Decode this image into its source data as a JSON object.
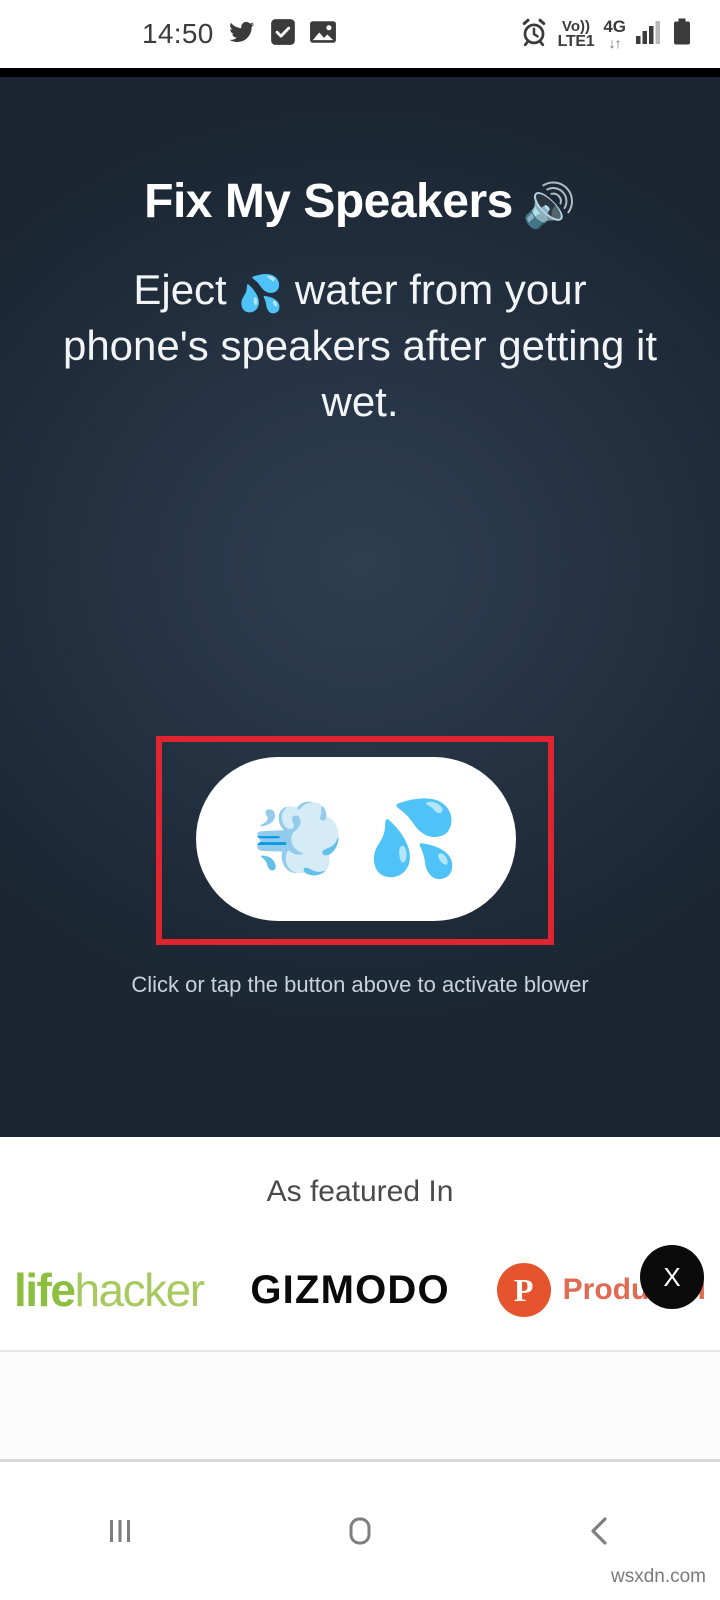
{
  "status_bar": {
    "time": "14:50",
    "left_icons": [
      "twitter-icon",
      "task-check-icon",
      "photo-icon"
    ],
    "alarm_icon": "alarm-icon",
    "volte_top": "Vo))",
    "volte_bottom": "LTE1",
    "network_label": "4G",
    "network_arrows": "↓↑",
    "signal_icon": "signal-bars-icon",
    "battery_icon": "battery-icon"
  },
  "hero": {
    "title": "Fix My Speakers",
    "title_emoji": "🔊",
    "subtitle_part1": "Eject",
    "subtitle_emoji": "💦",
    "subtitle_part2": "water from your phone's speakers after getting it wet.",
    "button": {
      "wind_emoji": "💨",
      "droplets_emoji": "💦",
      "aria_label": "activate blower"
    },
    "hint": "Click or tap the button above to activate blower",
    "annotation_color": "#e02530",
    "background_color": "#1e2a38"
  },
  "featured": {
    "title": "As featured In",
    "logos": [
      {
        "name": "lifehacker",
        "part_a": "life",
        "part_b": "hacker",
        "color_a": "#8cbf3f",
        "color_b": "#a8c95f"
      },
      {
        "name": "GIZMODO",
        "text": "GIZMODO",
        "color": "#0a0a0a"
      },
      {
        "name": "Product Hunt",
        "mark": "P",
        "text": "Product H",
        "color": "#e5542c"
      }
    ]
  },
  "close_button": {
    "label": "X"
  },
  "nav_bar": {
    "recents_label": "|||",
    "home_label": "home-square",
    "back_label": "‹"
  },
  "watermark": "wsxdn.com"
}
